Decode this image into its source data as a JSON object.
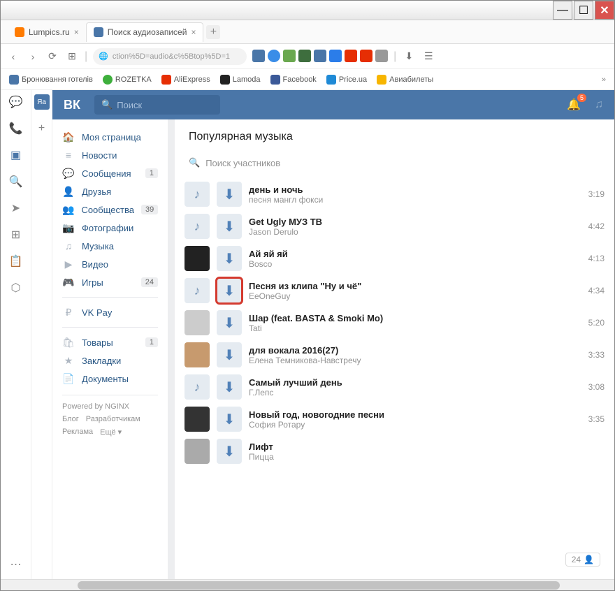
{
  "window": {
    "min": "—",
    "max": "☐",
    "close": "✕"
  },
  "tabs": [
    {
      "label": "Lumpics.ru",
      "fav": "#ff7b00"
    },
    {
      "label": "Поиск аудиозаписей",
      "fav": "#4a76a8"
    }
  ],
  "newtab": "+",
  "url": "ction%5D=audio&c%5Btop%5D=1",
  "bookmarks": [
    {
      "label": "Бронювання готелів",
      "color": "#4a76a8"
    },
    {
      "label": "ROZETKA",
      "color": "#3eaf3c"
    },
    {
      "label": "AliExpress",
      "color": "#e62e04"
    },
    {
      "label": "Lamoda",
      "color": "#222"
    },
    {
      "label": "Facebook",
      "color": "#3b5998"
    },
    {
      "label": "Price.ua",
      "color": "#1f8ad6"
    },
    {
      "label": "Авиабилеты",
      "color": "#f7b500"
    }
  ],
  "vk": {
    "logo": "ВК",
    "search_placeholder": "Поиск",
    "badge": "5"
  },
  "nav": [
    {
      "icon": "🏠",
      "label": "Моя страница"
    },
    {
      "icon": "≡",
      "label": "Новости"
    },
    {
      "icon": "💬",
      "label": "Сообщения",
      "badge": "1"
    },
    {
      "icon": "👤",
      "label": "Друзья"
    },
    {
      "icon": "👥",
      "label": "Сообщества",
      "badge": "39"
    },
    {
      "icon": "📷",
      "label": "Фотографии"
    },
    {
      "icon": "♫",
      "label": "Музыка"
    },
    {
      "icon": "▶",
      "label": "Видео"
    },
    {
      "icon": "🎮",
      "label": "Игры",
      "badge": "24"
    },
    {
      "sep": true
    },
    {
      "icon": "₽",
      "label": "VK Pay"
    },
    {
      "sep": true
    },
    {
      "icon": "🛍",
      "label": "Товары",
      "badge": "1"
    },
    {
      "icon": "★",
      "label": "Закладки"
    },
    {
      "icon": "📄",
      "label": "Документы"
    }
  ],
  "powered": "Powered by NGINX",
  "footer": {
    "blog": "Блог",
    "dev": "Разработчикам",
    "ads": "Реклама",
    "more": "Ещё ▾"
  },
  "section_title": "Популярная музыка",
  "search_hint": "Поиск участников",
  "tracks": [
    {
      "title": "день и ночь",
      "artist": "песня мангл фокси",
      "dur": "3:19",
      "thumb": "note"
    },
    {
      "title": "Get Ugly МУЗ ТВ",
      "artist": "Jason Derulo",
      "dur": "4:42",
      "thumb": "note"
    },
    {
      "title": "Ай яй яй",
      "artist": "Bosco",
      "dur": "4:13",
      "thumb": "img1"
    },
    {
      "title": "Песня из клипа \"Ну и чё\"",
      "artist": "EeOneGuy",
      "dur": "4:34",
      "thumb": "note",
      "hl": true
    },
    {
      "title": "Шар (feat. BASTA & Smoki Mo)",
      "artist": "Tati",
      "dur": "5:20",
      "thumb": "img2"
    },
    {
      "title": "для вокала 2016(27)",
      "artist": "Елена Темникова-Навстречу",
      "dur": "3:33",
      "thumb": "img3"
    },
    {
      "title": "Самый лучший день",
      "artist": "Г.Лепс",
      "dur": "3:08",
      "thumb": "note"
    },
    {
      "title": "Новый год, новогодние песни",
      "artist": "София Ротару",
      "dur": "3:35",
      "thumb": "img4"
    },
    {
      "title": "Лифт",
      "artist": "Пицца",
      "dur": "",
      "thumb": "img5"
    }
  ],
  "chip": "24"
}
